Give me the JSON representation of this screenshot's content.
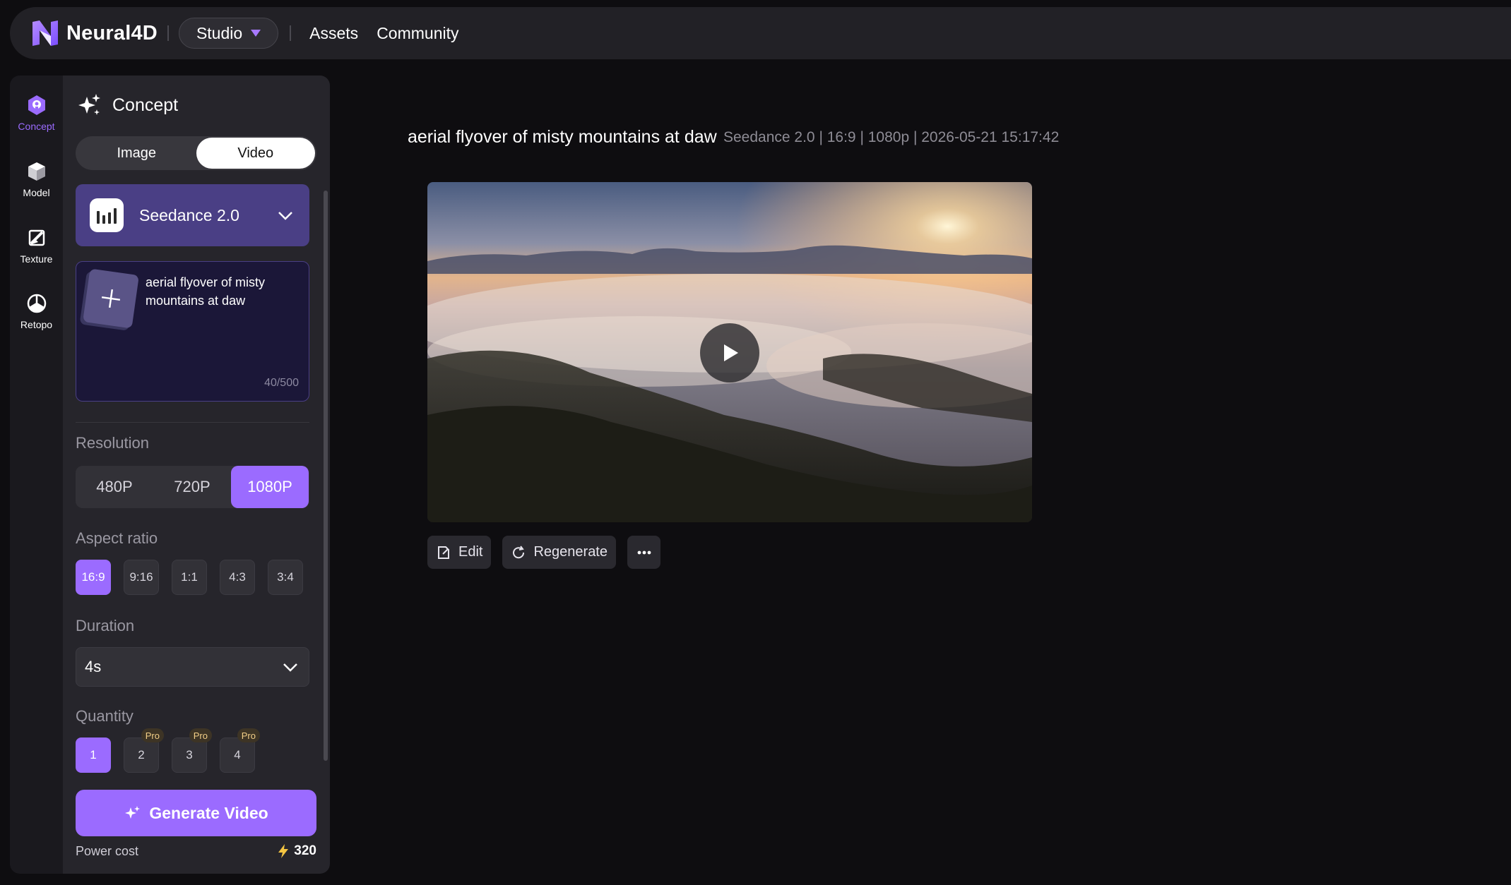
{
  "app": {
    "name": "Neural4D",
    "studio_label": "Studio",
    "nav": [
      "Assets",
      "Community"
    ]
  },
  "rail": [
    {
      "label": "Concept",
      "icon": "concept-icon",
      "active": true
    },
    {
      "label": "Model",
      "icon": "cube-icon",
      "active": false
    },
    {
      "label": "Texture",
      "icon": "texture-icon",
      "active": false
    },
    {
      "label": "Retopo",
      "icon": "retopo-icon",
      "active": false
    }
  ],
  "panel": {
    "title": "Concept",
    "mode_options": [
      "Image",
      "Video"
    ],
    "mode_selected": "Video",
    "model_name": "Seedance 2.0",
    "prompt": "aerial flyover of misty mountains at daw",
    "char_count": "40/500",
    "resolution_label": "Resolution",
    "resolutions": [
      "480P",
      "720P",
      "1080P"
    ],
    "resolution_selected": "1080P",
    "aspect_label": "Aspect ratio",
    "aspects": [
      "16:9",
      "9:16",
      "1:1",
      "4:3",
      "3:4"
    ],
    "aspect_selected": "16:9",
    "duration_label": "Duration",
    "duration_value": "4s",
    "quantity_label": "Quantity",
    "quantities": [
      "1",
      "2",
      "3",
      "4"
    ],
    "quantity_selected": "1",
    "pro_badge": "Pro",
    "generate_label": "Generate Video",
    "power_label": "Power cost",
    "power_value": "320"
  },
  "result": {
    "title": "aerial flyover of misty mountains at daw",
    "meta": "Seedance 2.0 | 16:9 | 1080p | 2026-05-21 15:17:42",
    "actions": {
      "edit": "Edit",
      "regenerate": "Regenerate"
    }
  },
  "colors": {
    "accent": "#9b6bff",
    "model_card": "#4a3f85",
    "background": "#0e0d10"
  }
}
